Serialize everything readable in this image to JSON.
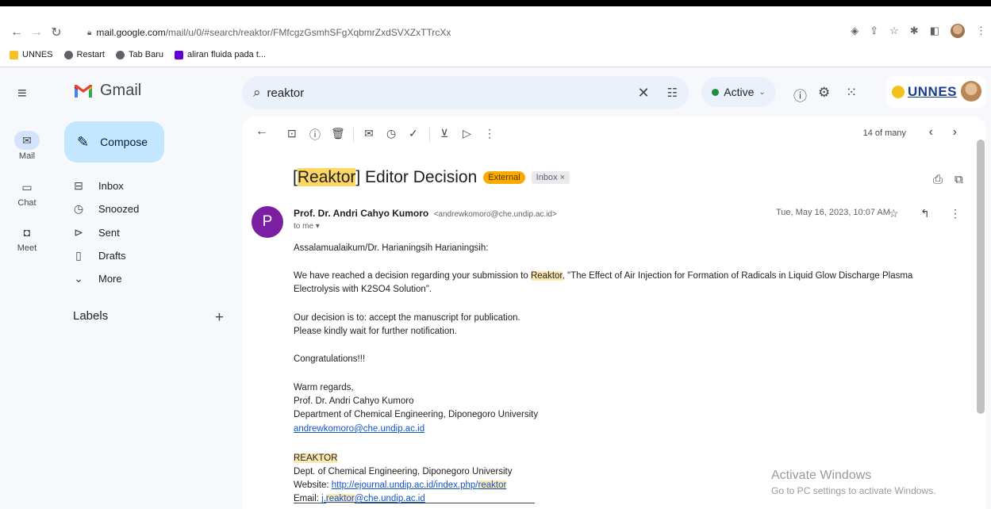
{
  "browser": {
    "url_host": "mail.google.com",
    "url_path": "/mail/u/0/#search/reaktor/FMfcgzGsmhSFgXqbmrZxdSVXZxTTrcXx",
    "bookmarks": [
      {
        "label": "UNNES",
        "color": "#f6c026"
      },
      {
        "label": "Restart",
        "color": "#5f6368"
      },
      {
        "label": "Tab Baru",
        "color": "#5f6368"
      },
      {
        "label": "aliran fluida pada t...",
        "color": "#6001d2"
      }
    ]
  },
  "gmail": {
    "logo_text": "Gmail",
    "search_value": "reaktor",
    "status": "Active",
    "brand": "UNNES"
  },
  "rail": {
    "mail": "Mail",
    "chat": "Chat",
    "meet": "Meet"
  },
  "sidebar": {
    "compose": "Compose",
    "items": [
      {
        "label": "Inbox"
      },
      {
        "label": "Snoozed"
      },
      {
        "label": "Sent"
      },
      {
        "label": "Drafts"
      },
      {
        "label": "More"
      }
    ],
    "labels_header": "Labels"
  },
  "toolbar": {
    "pager": "14 of many"
  },
  "message": {
    "subject_highlight": "Reaktor",
    "subject_rest": " Editor Decision",
    "badge_external": "External",
    "badge_inbox": "Inbox ×",
    "avatar_letter": "P",
    "sender_name": "Prof. Dr. Andri Cahyo Kumoro",
    "sender_email": "<andrewkomoro@che.undip.ac.id>",
    "to": "to me",
    "date": "Tue, May 16, 2023, 10:07 AM",
    "greeting": "Assalamualaikum/Dr. Harianingsih Harianingsih:",
    "p1_a": "We have reached a decision regarding your submission to ",
    "p1_hl": "Reaktor",
    "p1_b": ", \"The Effect of Air Injection for Formation of Radicals in Liquid Glow Discharge Plasma",
    "p1_c": "Electrolysis with K2SO4 Solution\".",
    "p2": "Our decision is to: accept the manuscript for publication.",
    "p3": "Please kindly wait for further notification.",
    "p4": "Congratulations!!!",
    "sig1": "Warm regards,",
    "sig2": "Prof. Dr. Andri Cahyo Kumoro",
    "sig3": "Department of Chemical Engineering, Diponegoro University",
    "sig_email": "andrewkomoro@che.undip.ac.id",
    "journal": "REAKTOR",
    "journal_dept": "Dept. of Chemical Engineering, Diponegoro University",
    "website_label": "Website: ",
    "website_a": "http://ejournal.undip.ac.id/index.php/",
    "website_hl": "reaktor",
    "email_label": "Email: ",
    "email_a": "j.",
    "email_hl": "reaktor",
    "email_b": "@che.undip.ac.id"
  },
  "watermark": {
    "line1": "Activate Windows",
    "line2": "Go to PC settings to activate Windows."
  }
}
